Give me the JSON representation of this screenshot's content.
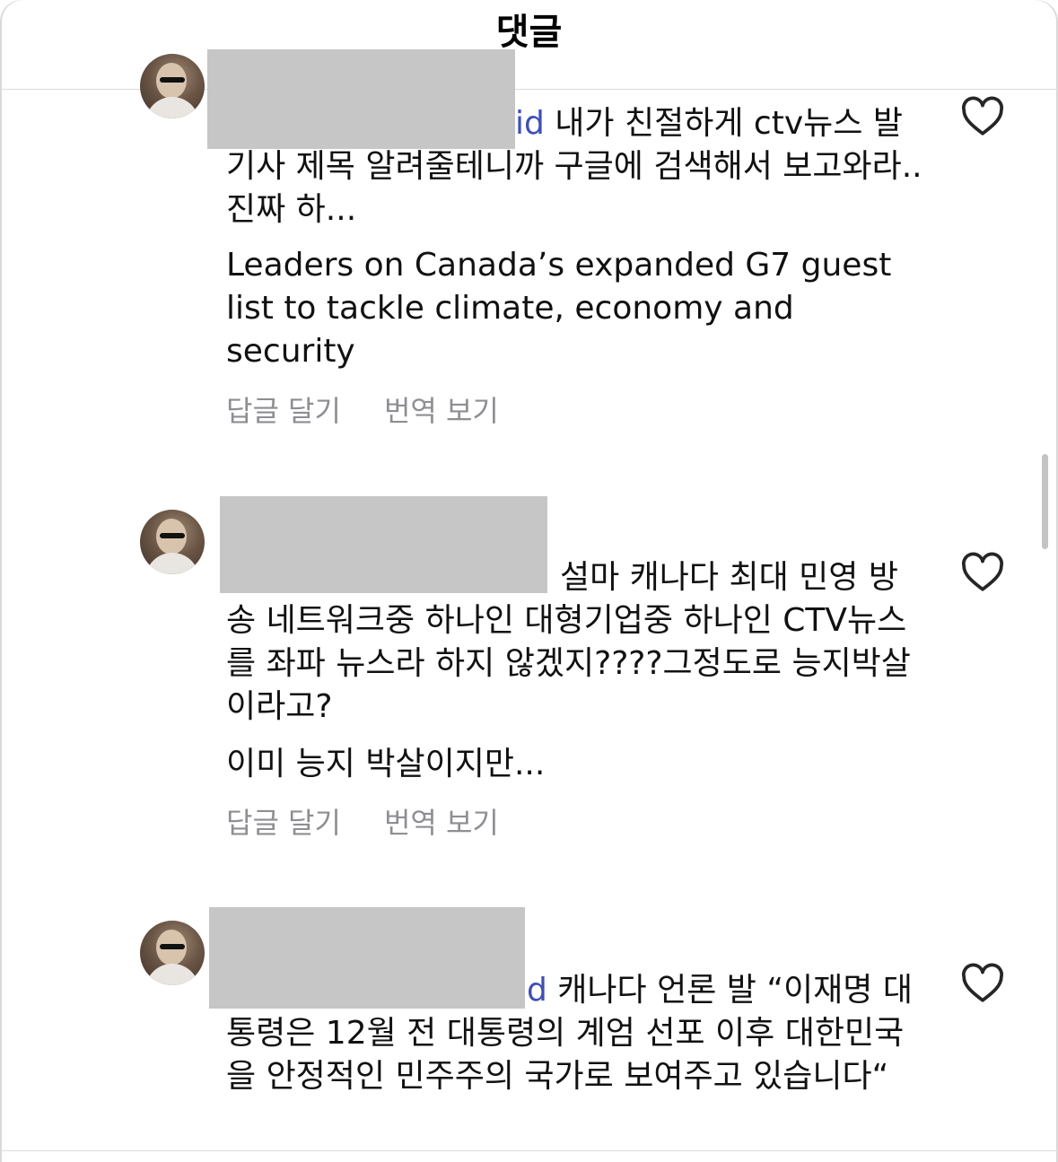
{
  "header": {
    "title": "댓글"
  },
  "comments": [
    {
      "mention_tail": "id",
      "text_first": " 내가 친절하게 ctv뉴스",
      "text_rest": "발 기사 제목 알려줄테니까 구글에 검색해서 보고와라..진짜 하...",
      "paragraph2": "Leaders on Canada’s expanded G7 guest list to tackle climate, economy and security",
      "reply_label": "답글 달기",
      "translate_label": "번역 보기"
    },
    {
      "text_first": "설마 캐나다 최대 민영",
      "text_rest": "방송 네트워크중 하나인 대형기업중 하나인 CTV뉴스를 좌파 뉴스라 하지 않겠지????그정도로 능지박살이라고?",
      "paragraph2": "이미 능지 박살이지만...",
      "reply_label": "답글 달기",
      "translate_label": "번역 보기"
    },
    {
      "mention_tail": "d",
      "text_first": " 캐나다 언론 발 “이재명",
      "text_rest": "대통령은 12월 전 대통령의 계엄 선포 이후 대한민국을 안정적인 민주주의 국가로 보여주고 있습니다“"
    }
  ],
  "icons": {
    "like": "heart-outline-icon",
    "avatar": "user-avatar"
  },
  "colors": {
    "mention": "#3f4fb3",
    "secondary_text": "#8e8e93",
    "redaction": "#c6c6c6"
  }
}
